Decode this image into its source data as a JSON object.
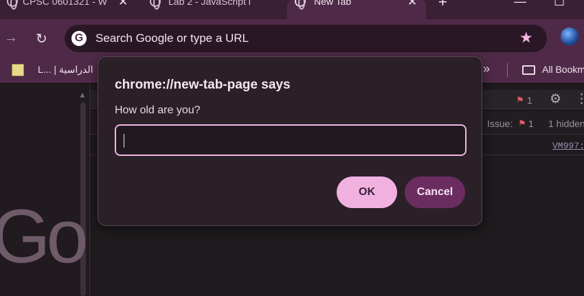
{
  "tabs": [
    {
      "title": "CPSC 0601321 - W",
      "icon": "globe-icon",
      "close": "✕"
    },
    {
      "title": "Lab 2 - JavaScript i",
      "icon": "globe-icon",
      "close": ""
    },
    {
      "title": "New Tab",
      "icon": "chrome-icon",
      "close": "✕"
    }
  ],
  "new_tab_glyph": "+",
  "window_controls": {
    "minimize": "—",
    "maximize": "☐"
  },
  "omnibox": {
    "text": "Search Google or type a URL",
    "logo": "G"
  },
  "bookmarks": {
    "first_item": "L... | الدراسية",
    "overflow": "»",
    "all_bookmarks": "All Bookm"
  },
  "devtools": {
    "issue_count_top": "1",
    "issues_label": "Issue:",
    "issues_count": "1",
    "hidden_label": "1 hidden",
    "source_link": "VM997:"
  },
  "dialog": {
    "title": "chrome://new-tab-page says",
    "message": "How old are you?",
    "input_value": "",
    "ok_label": "OK",
    "cancel_label": "Cancel"
  },
  "page_logo_text": "Go",
  "colors": {
    "accent": "#f1b1e0",
    "cancel_bg": "#6b2c60",
    "toolbar_bg": "#4f2a48",
    "tabstrip_bg": "#3a1f35"
  }
}
